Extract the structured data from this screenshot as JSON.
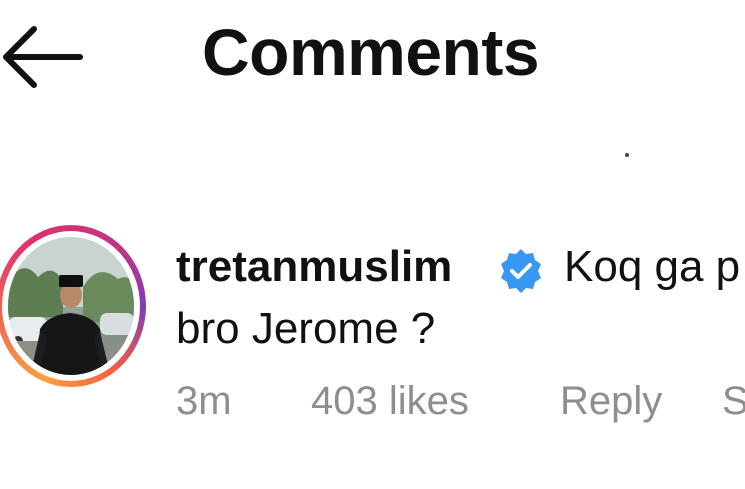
{
  "header": {
    "title": "Comments",
    "back_icon": "arrow-left-icon"
  },
  "comment": {
    "username": "tretanmuslim",
    "verified_icon": "verified-badge-icon",
    "verified_color": "#3897f0",
    "text_line1": "Koq ga p",
    "text_line2": "bro Jerome ?",
    "time": "3m",
    "likes": "403 likes",
    "reply_label": "Reply",
    "more_label": "S",
    "story_ring_colors": [
      "#f9a03f",
      "#e1306c",
      "#c13584",
      "#833ab4"
    ]
  }
}
